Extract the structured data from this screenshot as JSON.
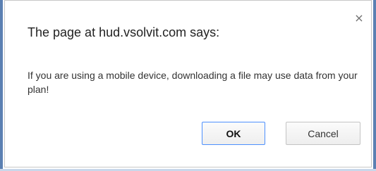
{
  "dialog": {
    "title": "The page at hud.vsolvit.com says:",
    "message": "If you are using a mobile device, downloading a file may use data from your plan!",
    "close_icon": "close-icon",
    "ok_label": "OK",
    "cancel_label": "Cancel"
  },
  "colors": {
    "frame_accent": "#5b80b2",
    "ok_border": "#4d90fe"
  }
}
